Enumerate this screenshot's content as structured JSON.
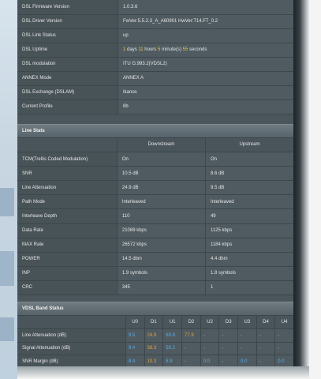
{
  "dsl_info": [
    {
      "label": "DSL Firmware Version",
      "value": "1.0.3.6"
    },
    {
      "label": "DSL Driver Version",
      "value": "FwVer:5.5.2.3_A_A60901 HwVer:T14.F7_0.2"
    },
    {
      "label": "DSL Link Status",
      "value": "up"
    },
    {
      "label": "DSL Uptime",
      "value": ""
    },
    {
      "label": "DSL modulation",
      "value": "ITU G.993.2(VDSL2)"
    },
    {
      "label": "ANNEX Mode",
      "value": "ANNEX A"
    },
    {
      "label": "DSL Exchange (DSLAM)",
      "value": "Ikanos"
    },
    {
      "label": "Current Profile",
      "value": "8b"
    }
  ],
  "uptime": {
    "days": "1",
    "days_unit": "days",
    "hours": "11",
    "hours_unit": "hours",
    "minutes": "5",
    "minutes_unit": "minute(s)",
    "seconds": "55",
    "seconds_unit": "seconds"
  },
  "line_stats": {
    "title": "Line Stats",
    "col_down": "Downstream",
    "col_up": "Upstream",
    "rows": [
      {
        "label": "TCM(Trellis Coded Modulation)",
        "down": "On",
        "up": "On"
      },
      {
        "label": "SNR",
        "down": "10.5 dB",
        "up": "8.6 dB"
      },
      {
        "label": "Line Attenuation",
        "down": "24.9 dB",
        "up": "9.5 dB"
      },
      {
        "label": "Path Mode",
        "down": "Interleaved",
        "up": "Interleaved"
      },
      {
        "label": "Interleave Depth",
        "down": "110",
        "up": "49"
      },
      {
        "label": "Data Rate",
        "down": "21089 kbps",
        "up": "1125 kbps"
      },
      {
        "label": "MAX Rate",
        "down": "26572 kbps",
        "up": "1184 kbps"
      },
      {
        "label": "POWER",
        "down": "14.5 dbm",
        "up": "4.4 dbm"
      },
      {
        "label": "INP",
        "down": "1.9 symbols",
        "up": "1.8 symbols"
      },
      {
        "label": "CRC",
        "down": "345",
        "up": "1"
      }
    ]
  },
  "vdsl_band": {
    "title": "VDSL Band Status",
    "bands": [
      "U0",
      "D1",
      "U1",
      "D2",
      "U2",
      "D3",
      "U3",
      "D4",
      "U4"
    ],
    "rows": [
      {
        "label": "Line Attenuation (dB)",
        "values": [
          "9.5",
          "24.9",
          "60.8",
          "77.9",
          "-",
          "-",
          "-",
          "-",
          "-"
        ]
      },
      {
        "label": "Signal Attenuation (dB)",
        "values": [
          "9.4",
          "38.3",
          "59.2",
          "-",
          "-",
          "-",
          "-",
          "-",
          "-"
        ]
      },
      {
        "label": "SNR Margin (dB)",
        "values": [
          "8.4",
          "10.3",
          "8.9",
          "-",
          "0.0",
          "-",
          "0.0",
          "-",
          "0.0"
        ]
      }
    ]
  },
  "colors": {
    "panel": "#4b565c",
    "blue": "#5aaee6",
    "orange": "#e8a03a",
    "yellow": "#f6c343"
  }
}
